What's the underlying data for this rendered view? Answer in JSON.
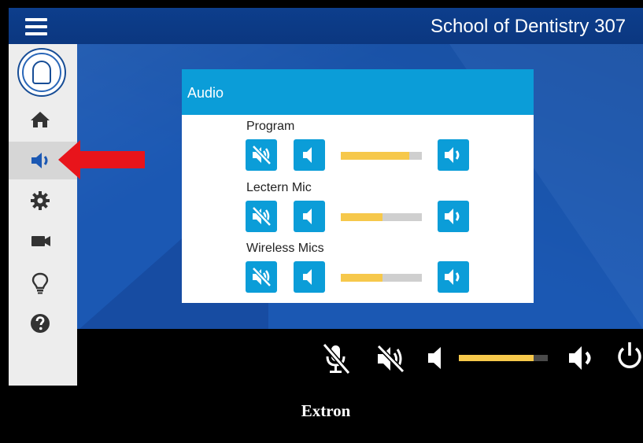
{
  "header": {
    "title": "School of Dentistry 307"
  },
  "sidebar": {
    "items": [
      {
        "icon": "home-icon",
        "active": false
      },
      {
        "icon": "speaker-icon",
        "active": true
      },
      {
        "icon": "gear-icon",
        "active": false
      },
      {
        "icon": "video-camera-icon",
        "active": false
      },
      {
        "icon": "lightbulb-icon",
        "active": false
      },
      {
        "icon": "help-icon",
        "active": false
      }
    ]
  },
  "audio_panel": {
    "title": "Audio",
    "channels": [
      {
        "label": "Program",
        "level_percent": 84
      },
      {
        "label": "Lectern Mic",
        "level_percent": 51
      },
      {
        "label": "Wireless Mics",
        "level_percent": 51
      }
    ]
  },
  "bottom_bar": {
    "master_level_percent": 84
  },
  "footer": {
    "brand": "Extron"
  },
  "colors": {
    "accent": "#0b9dd8",
    "header_bg": "#0b3780",
    "main_bg": "#1b58b3",
    "slider_fill": "#f6c84b",
    "slider_track": "#cfcfcf",
    "arrow": "#e8141b"
  }
}
